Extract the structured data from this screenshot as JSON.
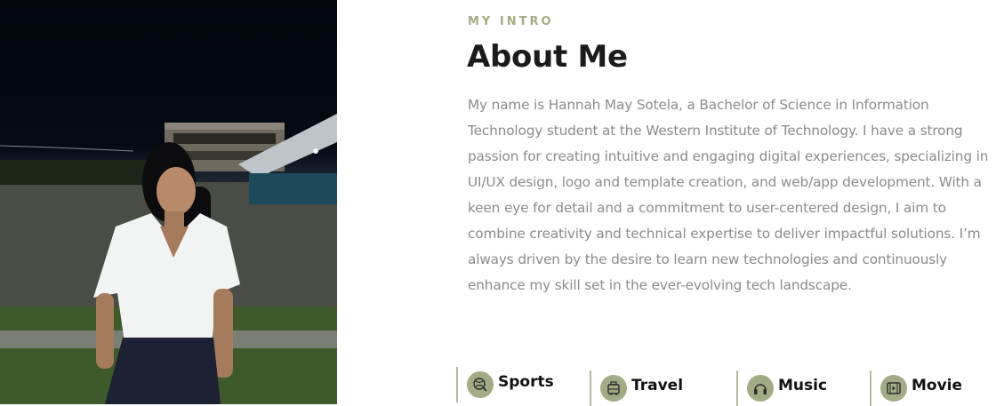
{
  "photo": {
    "alt": "Portrait photo"
  },
  "intro": {
    "eyebrow": "MY INTRO",
    "title": "About Me",
    "bio": "My name is Hannah May Sotela, a Bachelor of Science in Information Technology student at the Western Institute of Technology. I have a strong passion for creating intuitive and engaging digital experiences, specializing in UI/UX design, logo and template creation, and web/app development. With a keen eye for detail and a commitment to user-centered design, I aim to combine creativity and technical expertise to deliver impactful solutions. I’m always driven by the desire to learn new technologies and continuously enhance my skill set in the ever-evolving tech landscape."
  },
  "hobbies": [
    {
      "label": "Sports",
      "icon": "sports-icon"
    },
    {
      "label": "Travel",
      "icon": "travel-icon"
    },
    {
      "label": "Music",
      "icon": "music-icon"
    },
    {
      "label": "Movie",
      "icon": "movie-icon"
    }
  ],
  "colors": {
    "accent": "#a3ab86",
    "heading": "#1b1b1b",
    "body": "#8b8b8b"
  }
}
